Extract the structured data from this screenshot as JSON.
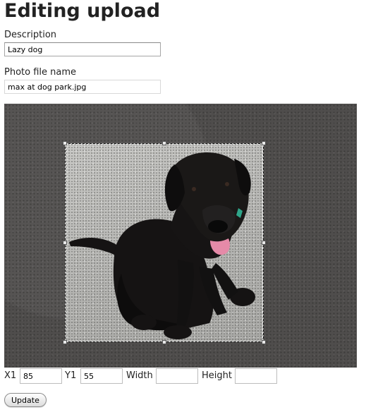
{
  "page": {
    "title": "Editing upload"
  },
  "form": {
    "description": {
      "label": "Description",
      "value": "Lazy dog"
    },
    "photo_file_name": {
      "label": "Photo file name",
      "value": "max at dog park.jpg"
    }
  },
  "crop": {
    "image_subject": "black labrador dog sitting on gravel",
    "x1": {
      "label": "X1",
      "value": "85"
    },
    "y1": {
      "label": "Y1",
      "value": "55"
    },
    "width": {
      "label": "Width",
      "value": ""
    },
    "height": {
      "label": "Height",
      "value": ""
    }
  },
  "actions": {
    "update_label": "Update"
  },
  "colors": {
    "dimmed_background": "#4f4d4c",
    "selection_gravel": "#b9b9b6",
    "dog_fur": "#151313",
    "tongue": "#e58aa8",
    "collar_tag": "#2fa58a"
  }
}
